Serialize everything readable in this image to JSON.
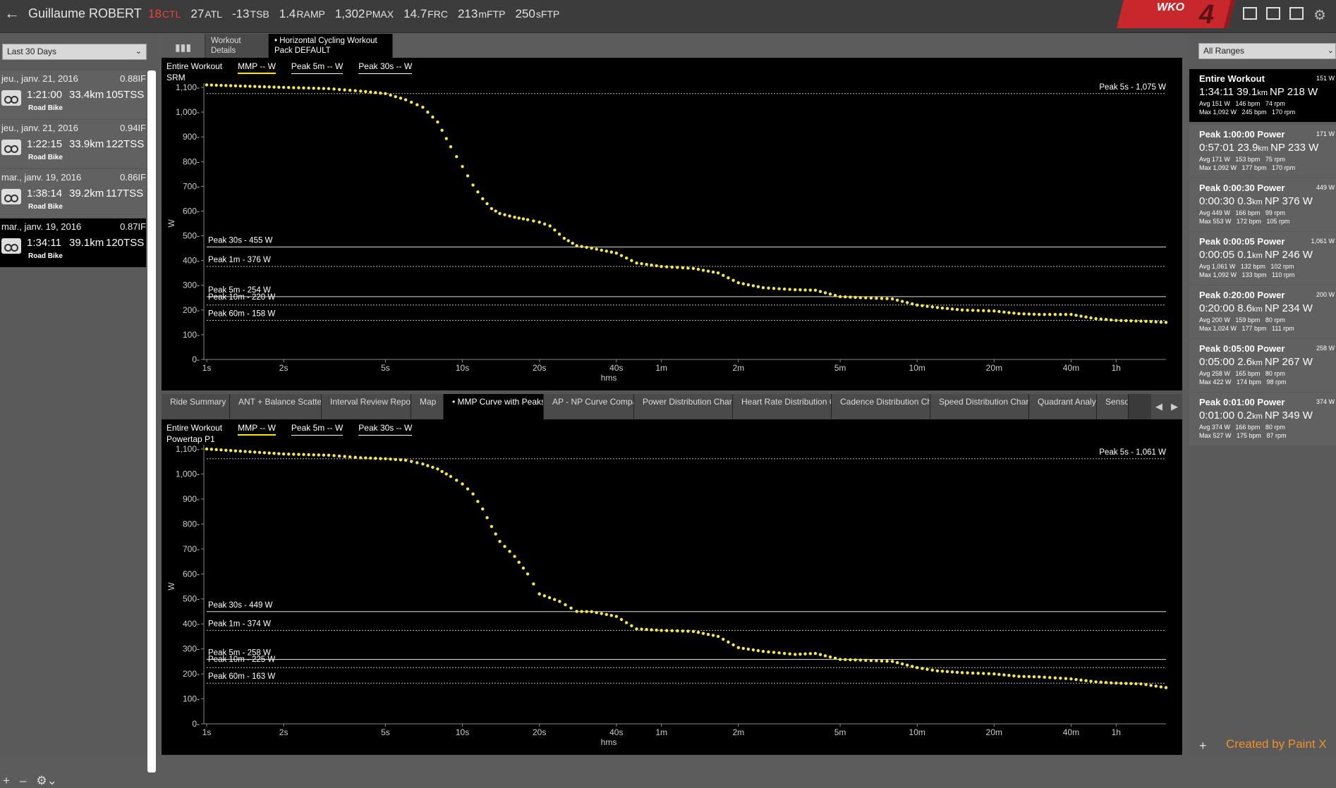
{
  "header": {
    "athlete": "Guillaume ROBERT",
    "metrics": [
      {
        "value": "18",
        "unit": "CTL",
        "color": "#f0403b"
      },
      {
        "value": "27",
        "unit": "ATL"
      },
      {
        "value": "-13",
        "unit": "TSB"
      },
      {
        "value": "1.4",
        "unit": "RAMP"
      },
      {
        "value": "1,302",
        "unit": "PMAX"
      },
      {
        "value": "14.7",
        "unit": "FRC"
      },
      {
        "value": "213",
        "unit": "mFTP"
      },
      {
        "value": "250",
        "unit": "sFTP"
      }
    ],
    "logo_text": "WKO",
    "logo_version": "4"
  },
  "left": {
    "range": "Last 30 Days",
    "rides": [
      {
        "date": "jeu., janv. 21, 2016",
        "if": "0.88IF",
        "duration": "1:21:00",
        "distance": "33.4km",
        "tss": "105TSS",
        "sport": "Road Bike",
        "selected": false
      },
      {
        "date": "jeu., janv. 21, 2016",
        "if": "0.94IF",
        "duration": "1:22:15",
        "distance": "33.9km",
        "tss": "122TSS",
        "sport": "Road Bike",
        "selected": false
      },
      {
        "date": "mar., janv. 19, 2016",
        "if": "0.86IF",
        "duration": "1:38:14",
        "distance": "39.2km",
        "tss": "117TSS",
        "sport": "Road Bike",
        "selected": false
      },
      {
        "date": "mar., janv. 19, 2016",
        "if": "0.87IF",
        "duration": "1:34:11",
        "distance": "39.1km",
        "tss": "120TSS",
        "sport": "Road Bike",
        "selected": true
      }
    ]
  },
  "top_tabs": [
    {
      "label": "Workout Details",
      "selected": false
    },
    {
      "label": "• Horizontal Cycling Workout Pack DEFAULT",
      "selected": true
    }
  ],
  "mid_tabs": [
    {
      "label": "Ride Summary",
      "selected": false
    },
    {
      "label": "ANT + Balance Scatter Plot",
      "selected": false
    },
    {
      "label": "Interval Review Report",
      "selected": false
    },
    {
      "label": "Map",
      "selected": false
    },
    {
      "label": "• MMP Curve with Peaks Chart",
      "selected": true
    },
    {
      "label": "AP - NP Curve Comparison",
      "selected": false
    },
    {
      "label": "Power Distribution Chart",
      "selected": false
    },
    {
      "label": "Heart Rate Distribution Chart",
      "selected": false
    },
    {
      "label": "Cadence Distribution Chart",
      "selected": false
    },
    {
      "label": "Speed Distribution Chart",
      "selected": false
    },
    {
      "label": "Quadrant Analysis",
      "selected": false
    },
    {
      "label": "Sensor Data",
      "selected": false
    }
  ],
  "right": {
    "range": "All Ranges",
    "ranges": [
      {
        "title": "Entire Workout",
        "avg_power": "151 W",
        "duration": "1:34:11",
        "distance": "39.1",
        "np": "NP 218 W",
        "avg": "Avg 151 W   146 bpm   74 rpm",
        "max": "Max 1,092 W   245 bpm   170 rpm",
        "selected": true
      },
      {
        "title": "Peak 1:00:00 Power",
        "avg_power": "171 W",
        "duration": "0:57:01",
        "distance": "23.9",
        "np": "NP 233 W",
        "avg": "Avg 171 W   153 bpm   75 rpm",
        "max": "Max 1,092 W   177 bpm   170 rpm",
        "selected": false
      },
      {
        "title": "Peak 0:00:30 Power",
        "avg_power": "449 W",
        "duration": "0:00:30",
        "distance": "0.3",
        "np": "NP 376 W",
        "avg": "Avg 449 W   166 bpm   99 rpm",
        "max": "Max 553 W   172 bpm   105 rpm",
        "selected": false
      },
      {
        "title": "Peak 0:00:05 Power",
        "avg_power": "1,061 W",
        "duration": "0:00:05",
        "distance": "0.1",
        "np": "NP 246 W",
        "avg": "Avg 1,061 W   132 bpm   102 rpm",
        "max": "Max 1,092 W   133 bpm   110 rpm",
        "selected": false
      },
      {
        "title": "Peak 0:20:00 Power",
        "avg_power": "200 W",
        "duration": "0:20:00",
        "distance": "8.6",
        "np": "NP 234 W",
        "avg": "Avg 200 W   159 bpm   80 rpm",
        "max": "Max 1,024 W   177 bpm   111 rpm",
        "selected": false
      },
      {
        "title": "Peak 0:05:00 Power",
        "avg_power": "258 W",
        "duration": "0:05:00",
        "distance": "2.6",
        "np": "NP 267 W",
        "avg": "Avg 258 W   165 bpm   80 rpm",
        "max": "Max 422 W   174 bpm   98 rpm",
        "selected": false
      },
      {
        "title": "Peak 0:01:00 Power",
        "avg_power": "374 W",
        "duration": "0:01:00",
        "distance": "0.2",
        "np": "NP 349 W",
        "avg": "Avg 374 W   166 bpm   80 rpm",
        "max": "Max 527 W   175 bpm   87 rpm",
        "selected": false
      }
    ],
    "credit": "Created by Paint X"
  },
  "chart_data": [
    {
      "type": "scatter",
      "device": "SRM",
      "legend": [
        "Entire Workout",
        "MMP -- W",
        "Peak 5m -- W",
        "Peak 30s -- W"
      ],
      "xlabel": "hms",
      "ylabel": "W",
      "log_x": true,
      "x_ticks": [
        "1s",
        "2s",
        "5s",
        "10s",
        "20s",
        "40s",
        "1m",
        "2m",
        "5m",
        "10m",
        "20m",
        "40m",
        "1h"
      ],
      "y_ticks": [
        "0",
        "100",
        "200",
        "300",
        "400",
        "500",
        "600",
        "700",
        "800",
        "900",
        "1,000",
        "1,100"
      ],
      "ylim": [
        0,
        1100
      ],
      "color": "#f5e84a",
      "peaks": [
        {
          "label": "Peak 5s - 1,075 W",
          "value": 1075
        },
        {
          "label": "Peak 30s - 455 W",
          "value": 455
        },
        {
          "label": "Peak 1m - 376 W",
          "value": 376
        },
        {
          "label": "Peak 5m - 254 W",
          "value": 254
        },
        {
          "label": "Peak 10m - 220 W",
          "value": 220
        },
        {
          "label": "Peak 60m - 158 W",
          "value": 158
        }
      ],
      "points": [
        [
          1,
          1110
        ],
        [
          2,
          1100
        ],
        [
          3,
          1095
        ],
        [
          4,
          1085
        ],
        [
          5,
          1075
        ],
        [
          6,
          1050
        ],
        [
          7,
          1020
        ],
        [
          8,
          960
        ],
        [
          9,
          860
        ],
        [
          10,
          780
        ],
        [
          11,
          705
        ],
        [
          12,
          650
        ],
        [
          13,
          610
        ],
        [
          14,
          590
        ],
        [
          16,
          575
        ],
        [
          18,
          565
        ],
        [
          20,
          555
        ],
        [
          22,
          540
        ],
        [
          25,
          490
        ],
        [
          28,
          460
        ],
        [
          32,
          450
        ],
        [
          40,
          430
        ],
        [
          48,
          390
        ],
        [
          60,
          376
        ],
        [
          80,
          368
        ],
        [
          100,
          350
        ],
        [
          120,
          310
        ],
        [
          150,
          290
        ],
        [
          200,
          282
        ],
        [
          240,
          280
        ],
        [
          300,
          254
        ],
        [
          360,
          250
        ],
        [
          480,
          245
        ],
        [
          600,
          220
        ],
        [
          720,
          210
        ],
        [
          900,
          200
        ],
        [
          1200,
          196
        ],
        [
          1500,
          185
        ],
        [
          1800,
          182
        ],
        [
          2400,
          182
        ],
        [
          3000,
          165
        ],
        [
          3600,
          158
        ],
        [
          4500,
          155
        ],
        [
          5640,
          150
        ]
      ]
    },
    {
      "type": "scatter",
      "device": "Powertap P1",
      "legend": [
        "Entire Workout",
        "MMP -- W",
        "Peak 5m -- W",
        "Peak 30s -- W"
      ],
      "xlabel": "hms",
      "ylabel": "W",
      "log_x": true,
      "x_ticks": [
        "1s",
        "2s",
        "5s",
        "10s",
        "20s",
        "40s",
        "1m",
        "2m",
        "5m",
        "10m",
        "20m",
        "40m",
        "1h"
      ],
      "y_ticks": [
        "0",
        "100",
        "200",
        "300",
        "400",
        "500",
        "600",
        "700",
        "800",
        "900",
        "1,000",
        "1,100"
      ],
      "ylim": [
        0,
        1100
      ],
      "color": "#f5e84a",
      "peaks": [
        {
          "label": "Peak 5s - 1,061 W",
          "value": 1061
        },
        {
          "label": "Peak 30s - 449 W",
          "value": 449
        },
        {
          "label": "Peak 1m - 374 W",
          "value": 374
        },
        {
          "label": "Peak 5m - 258 W",
          "value": 258
        },
        {
          "label": "Peak 10m - 225 W",
          "value": 225
        },
        {
          "label": "Peak 60m - 163 W",
          "value": 163
        }
      ],
      "points": [
        [
          1,
          1100
        ],
        [
          2,
          1080
        ],
        [
          3,
          1075
        ],
        [
          4,
          1065
        ],
        [
          5,
          1061
        ],
        [
          6,
          1055
        ],
        [
          7,
          1040
        ],
        [
          8,
          1020
        ],
        [
          9,
          990
        ],
        [
          10,
          960
        ],
        [
          11,
          920
        ],
        [
          12,
          860
        ],
        [
          13,
          790
        ],
        [
          14,
          730
        ],
        [
          16,
          670
        ],
        [
          18,
          600
        ],
        [
          20,
          520
        ],
        [
          24,
          490
        ],
        [
          28,
          450
        ],
        [
          32,
          449
        ],
        [
          40,
          430
        ],
        [
          48,
          380
        ],
        [
          60,
          374
        ],
        [
          80,
          370
        ],
        [
          100,
          350
        ],
        [
          120,
          305
        ],
        [
          150,
          290
        ],
        [
          200,
          278
        ],
        [
          240,
          282
        ],
        [
          300,
          258
        ],
        [
          360,
          255
        ],
        [
          480,
          250
        ],
        [
          600,
          225
        ],
        [
          720,
          212
        ],
        [
          900,
          205
        ],
        [
          1200,
          200
        ],
        [
          1500,
          190
        ],
        [
          1800,
          188
        ],
        [
          2400,
          180
        ],
        [
          3000,
          168
        ],
        [
          3600,
          163
        ],
        [
          4500,
          160
        ],
        [
          5640,
          145
        ]
      ]
    }
  ]
}
